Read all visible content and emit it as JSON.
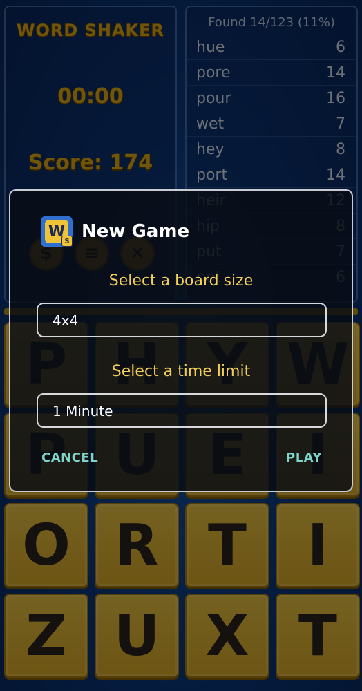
{
  "game": {
    "logo_text": "WORD SHAKER",
    "timer": "00:00",
    "score": "Score: 174",
    "tools": [
      {
        "icon": "dollar-icon",
        "glyph": "$"
      },
      {
        "icon": "menu-icon",
        "glyph": "≡"
      },
      {
        "icon": "close-icon",
        "glyph": "✕"
      }
    ]
  },
  "found_panel": {
    "header": "Found 14/123 (11%)",
    "words": [
      {
        "word": "hue",
        "score": "6"
      },
      {
        "word": "pore",
        "score": "14"
      },
      {
        "word": "pour",
        "score": "16"
      },
      {
        "word": "wet",
        "score": "7"
      },
      {
        "word": "hey",
        "score": "8"
      },
      {
        "word": "port",
        "score": "14"
      },
      {
        "word": "heir",
        "score": "12"
      },
      {
        "word": "hip",
        "score": "8"
      },
      {
        "word": "put",
        "score": "7"
      },
      {
        "word": "pot",
        "score": "6"
      }
    ]
  },
  "board": {
    "tiles": [
      [
        "P",
        "H",
        "Y",
        "W"
      ],
      [
        "P",
        "U",
        "E",
        "I"
      ],
      [
        "O",
        "R",
        "T",
        "I"
      ],
      [
        "Z",
        "U",
        "X",
        "T"
      ]
    ]
  },
  "dialog": {
    "title": "New Game",
    "board_size_label": "Select a board size",
    "board_size_value": "4x4",
    "time_limit_label": "Select a time limit",
    "time_limit_value": "1 Minute",
    "cancel_label": "CANCEL",
    "play_label": "PLAY"
  },
  "colors": {
    "accent_gold": "#e8b51a",
    "dialog_label": "#f2cf5a",
    "button_text": "#7fd3c9"
  }
}
